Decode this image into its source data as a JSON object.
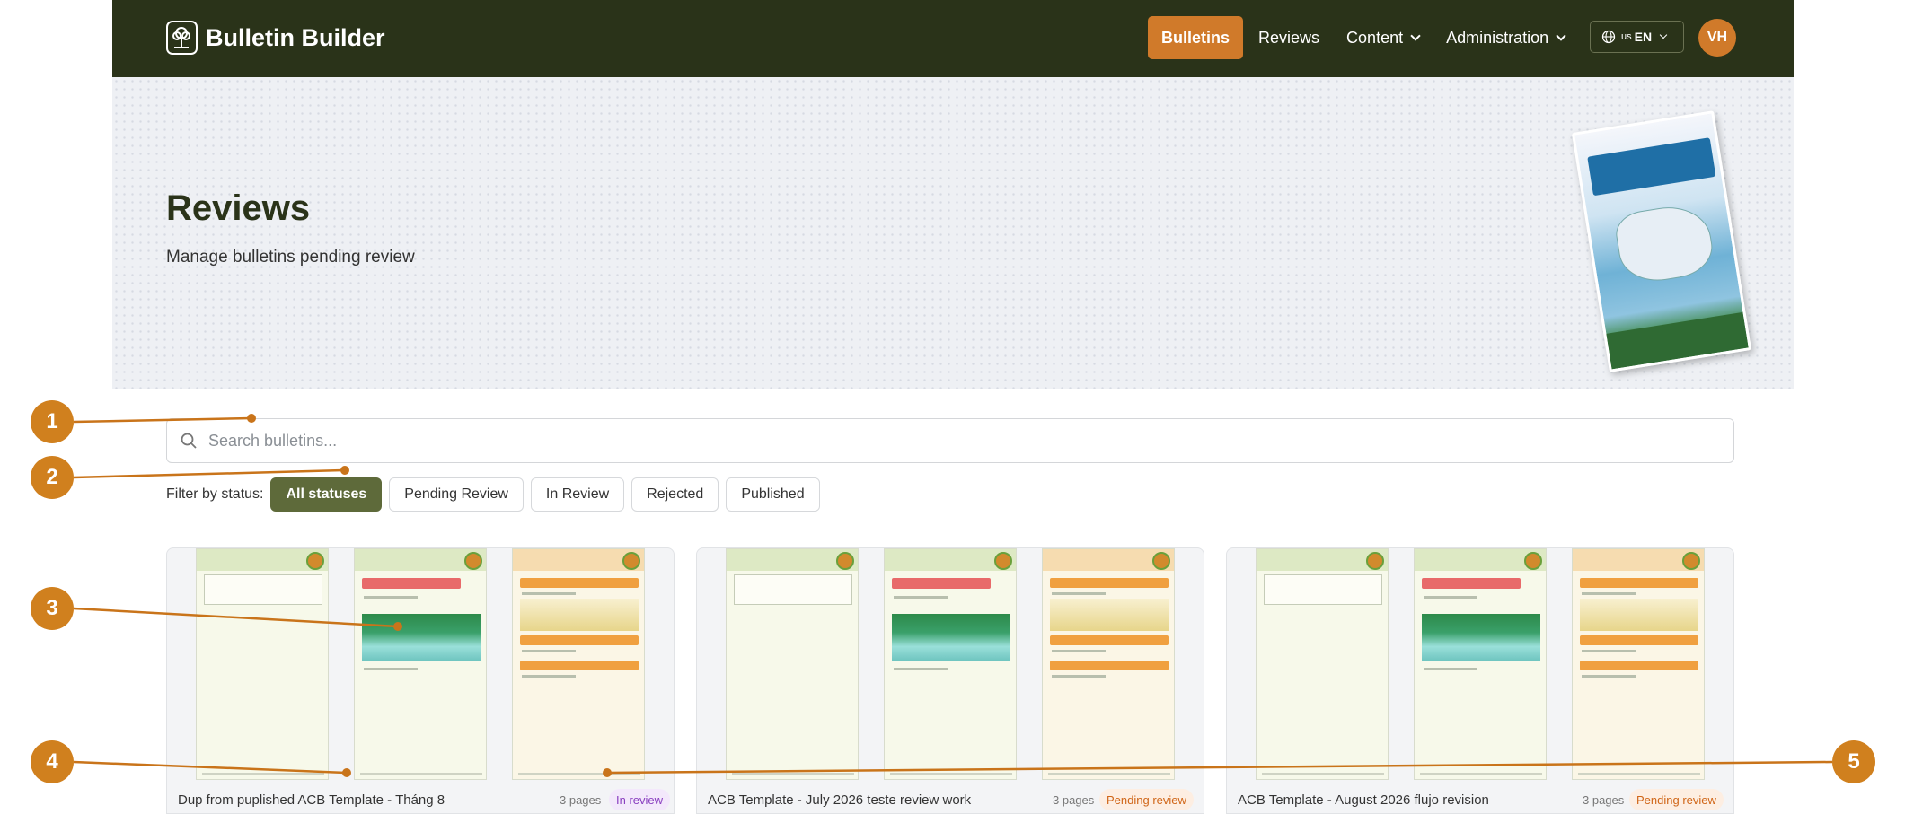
{
  "nav": {
    "brand": "Bulletin Builder",
    "links": [
      {
        "label": "Bulletins",
        "active": true
      },
      {
        "label": "Reviews",
        "active": false
      },
      {
        "label": "Content",
        "dropdown": true
      },
      {
        "label": "Administration",
        "dropdown": true
      }
    ],
    "language": {
      "flag": "us",
      "code": "EN"
    },
    "avatar_initials": "VH"
  },
  "hero": {
    "title": "Reviews",
    "subtitle": "Manage bulletins pending review"
  },
  "search": {
    "placeholder": "Search bulletins..."
  },
  "filters": {
    "label": "Filter by status:",
    "options": [
      "All statuses",
      "Pending Review",
      "In Review",
      "Rejected",
      "Published"
    ],
    "selected": "All statuses"
  },
  "cards": [
    {
      "title": "Dup from puplished ACB Template - Tháng 8",
      "pages": "3 pages",
      "status": "In review",
      "status_type": "review"
    },
    {
      "title": "ACB Template - July 2026 teste review work",
      "pages": "3 pages",
      "status": "Pending review",
      "status_type": "pending"
    },
    {
      "title": "ACB Template - August 2026 flujo revision",
      "pages": "3 pages",
      "status": "Pending review",
      "status_type": "pending"
    }
  ],
  "callouts": [
    "1",
    "2",
    "3",
    "4",
    "5"
  ],
  "colors": {
    "nav_bg": "#2a3319",
    "accent": "#d07a2a",
    "filter_active": "#5e6a3a",
    "callout": "#d0801e"
  }
}
